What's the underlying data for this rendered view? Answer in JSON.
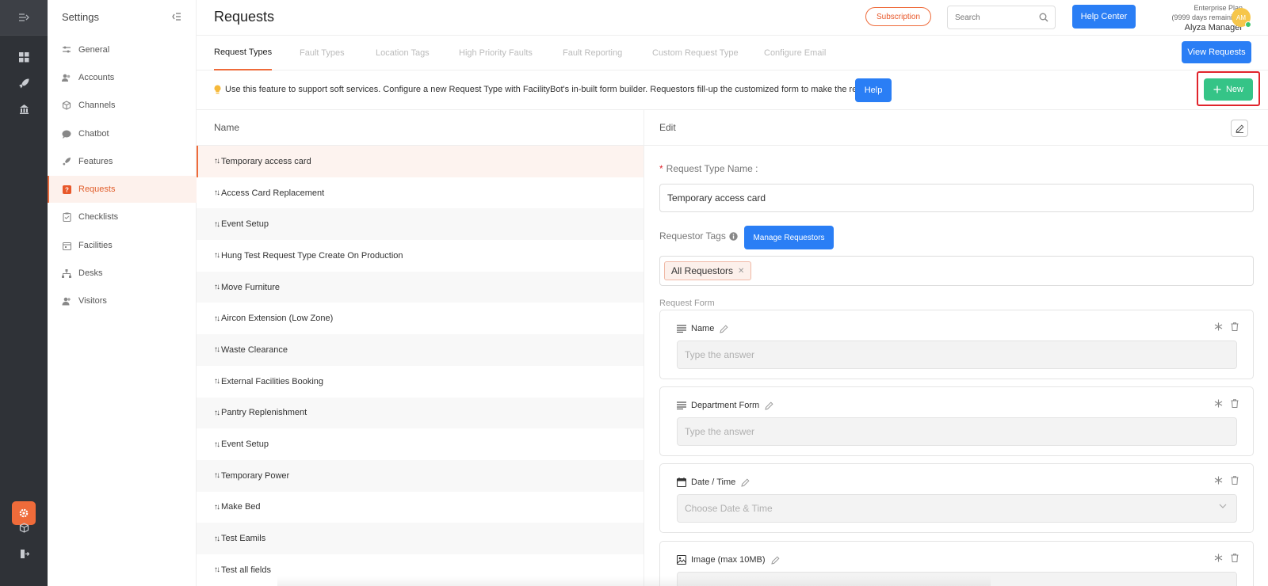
{
  "sidebar": {
    "title": "Settings",
    "items": [
      {
        "label": "General",
        "icon": "sliders-icon"
      },
      {
        "label": "Accounts",
        "icon": "users-icon"
      },
      {
        "label": "Channels",
        "icon": "cube-icon"
      },
      {
        "label": "Chatbot",
        "icon": "chat-icon"
      },
      {
        "label": "Features",
        "icon": "rocket-icon"
      },
      {
        "label": "Requests",
        "icon": "question-icon"
      },
      {
        "label": "Checklists",
        "icon": "clipboard-icon"
      },
      {
        "label": "Facilities",
        "icon": "calendar-icon"
      },
      {
        "label": "Desks",
        "icon": "sitemap-icon"
      },
      {
        "label": "Visitors",
        "icon": "visitor-icon"
      }
    ]
  },
  "header": {
    "title": "Requests",
    "subscription_label": "Subscription",
    "search_placeholder": "Search",
    "help_center_label": "Help Center",
    "plan_name": "Enterprise Plan",
    "plan_remaining": "(9999 days remaining)",
    "user_name": "Alyza Manager",
    "avatar_initials": "AM"
  },
  "tabs": {
    "items": [
      "Request Types",
      "Fault Types",
      "Location Tags",
      "High Priority Faults",
      "Fault Reporting",
      "Custom Request Type",
      "Configure Email"
    ],
    "view_requests_label": "View Requests"
  },
  "info": {
    "text": "Use this feature to support soft services. Configure a new Request Type with FacilityBot's in-built form builder. Requestors fill-up the customized form to make the request.",
    "help_label": "Help",
    "new_label": "New"
  },
  "list": {
    "header": "Name",
    "rows": [
      "Temporary access card",
      "Access Card Replacement",
      "Event Setup",
      "Hung Test Request Type Create On Production",
      "Move Furniture",
      "Aircon Extension (Low Zone)",
      "Waste Clearance",
      "External Facilities Booking",
      "Pantry Replenishment",
      "Event Setup",
      "Temporary Power",
      "Make Bed",
      "Test Eamils",
      "Test all fields"
    ]
  },
  "edit": {
    "header": "Edit",
    "name_label": "Request Type Name :",
    "name_value": "Temporary access card",
    "tags_label": "Requestor Tags",
    "manage_label": "Manage Requestors",
    "tag_value": "All Requestors",
    "form_label": "Request Form",
    "fields": [
      {
        "label": "Name",
        "placeholder": "Type the answer",
        "icon": "text-lines-icon"
      },
      {
        "label": "Department Form",
        "placeholder": "Type the answer",
        "icon": "text-lines-icon"
      },
      {
        "label": "Date / Time",
        "placeholder": "Choose Date & Time",
        "icon": "calendar-icon"
      },
      {
        "label": "Image (max 10MB)",
        "placeholder": "",
        "icon": "image-icon"
      }
    ]
  },
  "colors": {
    "accent": "#ef6b3a",
    "primary": "#2a7ef5",
    "success": "#35c487",
    "highlight": "#e0242c"
  }
}
